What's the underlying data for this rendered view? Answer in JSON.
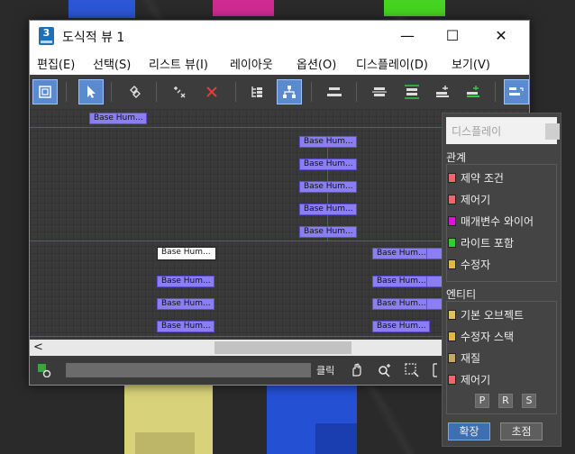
{
  "window": {
    "title": "도식적 뷰 1",
    "icon_label": "3",
    "controls": {
      "minimize": "—",
      "maximize": "☐",
      "close": "✕"
    }
  },
  "menu": [
    {
      "label": "편집(E)"
    },
    {
      "label": "선택(S)"
    },
    {
      "label": "리스트 뷰(I)"
    },
    {
      "label": "레이아웃"
    },
    {
      "label": "옵션(O)"
    },
    {
      "label": "디스플레이(D)"
    },
    {
      "label": "보기(V)"
    }
  ],
  "toolbar": {
    "icons": [
      "display-floater-icon",
      "select-icon",
      "connect-icon",
      "unlink-selected-icon",
      "delete-icon",
      "hierarchy-mode-icon",
      "references-mode-icon",
      "align-icon",
      "align-left-icon",
      "align-center-icon",
      "align-right-icon",
      "move-children-icon",
      "list-views-icon"
    ],
    "accent": "#5a8bd0"
  },
  "nodes": {
    "label": "Base Hum...",
    "count": 16
  },
  "statusbar": {
    "label": "클릭",
    "icons": [
      "pan-icon",
      "zoom-icon",
      "region-zoom-icon",
      "zoom-extents-icon"
    ]
  },
  "display_panel": {
    "title": "디스플레이",
    "relations_heading": "관계",
    "relations": [
      {
        "label": "제약 조건",
        "color": "#e86a6a"
      },
      {
        "label": "제어기",
        "color": "#e86a6a"
      },
      {
        "label": "매개변수 와이어",
        "color": "#d21ad2"
      },
      {
        "label": "라이트 포함",
        "color": "#33cc33"
      },
      {
        "label": "수정자",
        "color": "#e0b84a"
      }
    ],
    "entities_heading": "엔티티",
    "entities": [
      {
        "label": "기본 오브젝트",
        "color": "#e0c060"
      },
      {
        "label": "수정자 스택",
        "color": "#e0b84a"
      },
      {
        "label": "재질",
        "color": "#c8a860"
      },
      {
        "label": "제어기",
        "color": "#e86a6a"
      }
    ],
    "prs": [
      "P",
      "R",
      "S"
    ],
    "expand_label": "확장",
    "focus_label": "초점"
  }
}
